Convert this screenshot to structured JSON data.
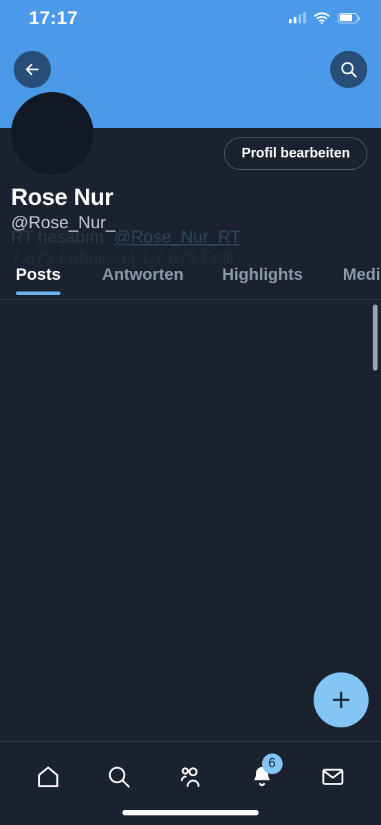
{
  "status_bar": {
    "time": "17:17",
    "signal_icon": "signal-bars-icon",
    "wifi_icon": "wifi-icon",
    "battery_icon": "battery-icon"
  },
  "header": {
    "banner_color": "#4a9ae9",
    "back_icon": "back-arrow-icon",
    "search_icon": "search-icon"
  },
  "profile": {
    "avatar": "profile-avatar",
    "edit_button_label": "Profil bearbeiten",
    "display_name": "Rose Nur",
    "handle": "@Rose_Nur_",
    "bio_ghost_line1_prefix": "RT hesabım: ",
    "bio_ghost_line1_link": "@Rose_Nur_RT",
    "bio_ghost_line2": "7.673 Fabriken | 1.7.673 Folli"
  },
  "tabs": [
    {
      "label": "Posts",
      "active": true
    },
    {
      "label": "Antworten",
      "active": false
    },
    {
      "label": "Highlights",
      "active": false
    },
    {
      "label": "Medien",
      "active": false
    }
  ],
  "feed": {
    "scrollbar": "vertical-scrollbar",
    "empty": ""
  },
  "compose": {
    "fab_icon": "plus-icon",
    "fab_color": "#83c5f5"
  },
  "bottom_nav": {
    "items": [
      {
        "name": "home",
        "icon": "home-icon",
        "badge": ""
      },
      {
        "name": "search",
        "icon": "search-icon",
        "badge": ""
      },
      {
        "name": "communities",
        "icon": "communities-icon",
        "badge": ""
      },
      {
        "name": "notifications",
        "icon": "bell-icon",
        "badge": "6"
      },
      {
        "name": "messages",
        "icon": "envelope-icon",
        "badge": ""
      }
    ],
    "badge_count": "6",
    "badge_color": "#83c5f5"
  },
  "colors": {
    "background": "#1a2230",
    "accent": "#6bb0ef",
    "banner": "#4a9ae9",
    "muted_text": "#8b98a5"
  }
}
